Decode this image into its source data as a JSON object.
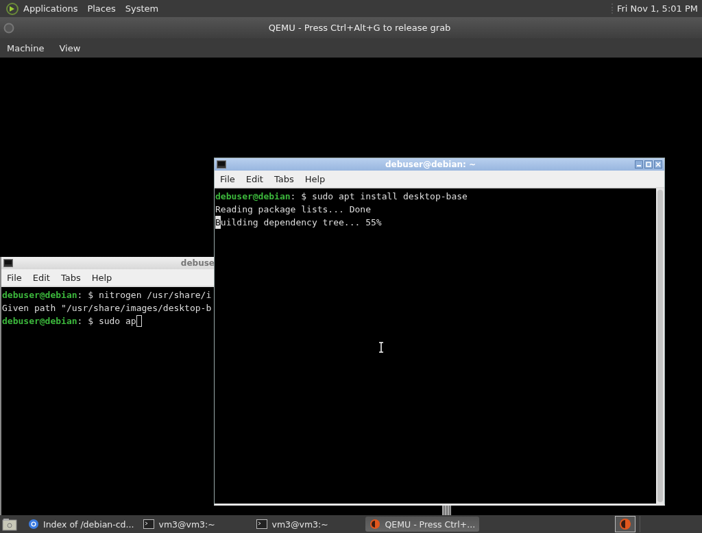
{
  "top_panel": {
    "menus": [
      "Applications",
      "Places",
      "System"
    ],
    "clock": "Fri Nov 1, 5:01 PM"
  },
  "qemu_window": {
    "title": "QEMU - Press Ctrl+Alt+G to release grab",
    "menus": [
      "Machine",
      "View"
    ]
  },
  "guest_windows": [
    {
      "title": "debuse",
      "focused": false,
      "menus": [
        "File",
        "Edit",
        "Tabs",
        "Help"
      ],
      "lines": [
        {
          "kind": "prompt",
          "user": "debuser@debian",
          "command": ": $ nitrogen /usr/share/i"
        },
        {
          "kind": "output",
          "text": "Given path \"/usr/share/images/desktop-b"
        },
        {
          "kind": "prompt",
          "user": "debuser@debian",
          "command": ": $ sudo ap",
          "cursor": true
        }
      ]
    },
    {
      "title": "debuser@debian: ~",
      "focused": true,
      "menus": [
        "File",
        "Edit",
        "Tabs",
        "Help"
      ],
      "lines": [
        {
          "kind": "prompt",
          "user": "debuser@debian",
          "command": ": $ sudo apt install desktop-base"
        },
        {
          "kind": "output",
          "text": "Reading package lists... Done"
        },
        {
          "kind": "output",
          "text": "Building dependency tree... 55%",
          "cursor": true
        }
      ]
    }
  ],
  "taskbar": {
    "items": [
      {
        "kind": "browser",
        "label": "Index of /debian-cd...",
        "selected": false
      },
      {
        "kind": "terminal",
        "label": "vm3@vm3:~",
        "selected": false
      },
      {
        "kind": "terminal",
        "label": "vm3@vm3:~",
        "selected": false
      },
      {
        "kind": "qemu",
        "label": "QEMU - Press Ctrl+...",
        "selected": true
      }
    ]
  }
}
